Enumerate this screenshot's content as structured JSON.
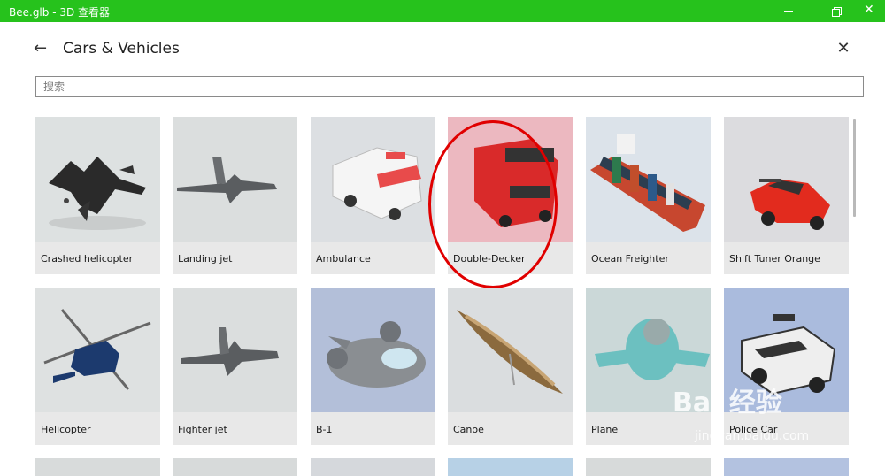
{
  "window": {
    "title": "Bee.glb - 3D 查看器"
  },
  "dialog": {
    "title": "Cars & Vehicles",
    "search_placeholder": "搜索"
  },
  "items": [
    {
      "label": "Crashed helicopter",
      "bg": "#d8dcdc"
    },
    {
      "label": "Landing jet",
      "bg": "#d7dada"
    },
    {
      "label": "Ambulance",
      "bg": "#d5d8dc"
    },
    {
      "label": "Double-Decker",
      "bg": "#ecb4bd"
    },
    {
      "label": "Ocean Freighter",
      "bg": "#d7dee6"
    },
    {
      "label": "Shift Tuner Orange",
      "bg": "#d7d7da"
    },
    {
      "label": "Helicopter",
      "bg": "#d9dcdc"
    },
    {
      "label": "Fighter jet",
      "bg": "#d6d9da"
    },
    {
      "label": "B-1",
      "bg": "#aeb9d4"
    },
    {
      "label": "Canoe",
      "bg": "#d6dadc"
    },
    {
      "label": "Plane",
      "bg": "#c9d6d6"
    },
    {
      "label": "Police Car",
      "bg": "#a7b7dc"
    }
  ],
  "watermark": {
    "brand": "Bai 经验",
    "url": "jingyan.baidu.com"
  },
  "colors": {
    "titlebar": "#26c21c",
    "highlight": "#e00000"
  }
}
